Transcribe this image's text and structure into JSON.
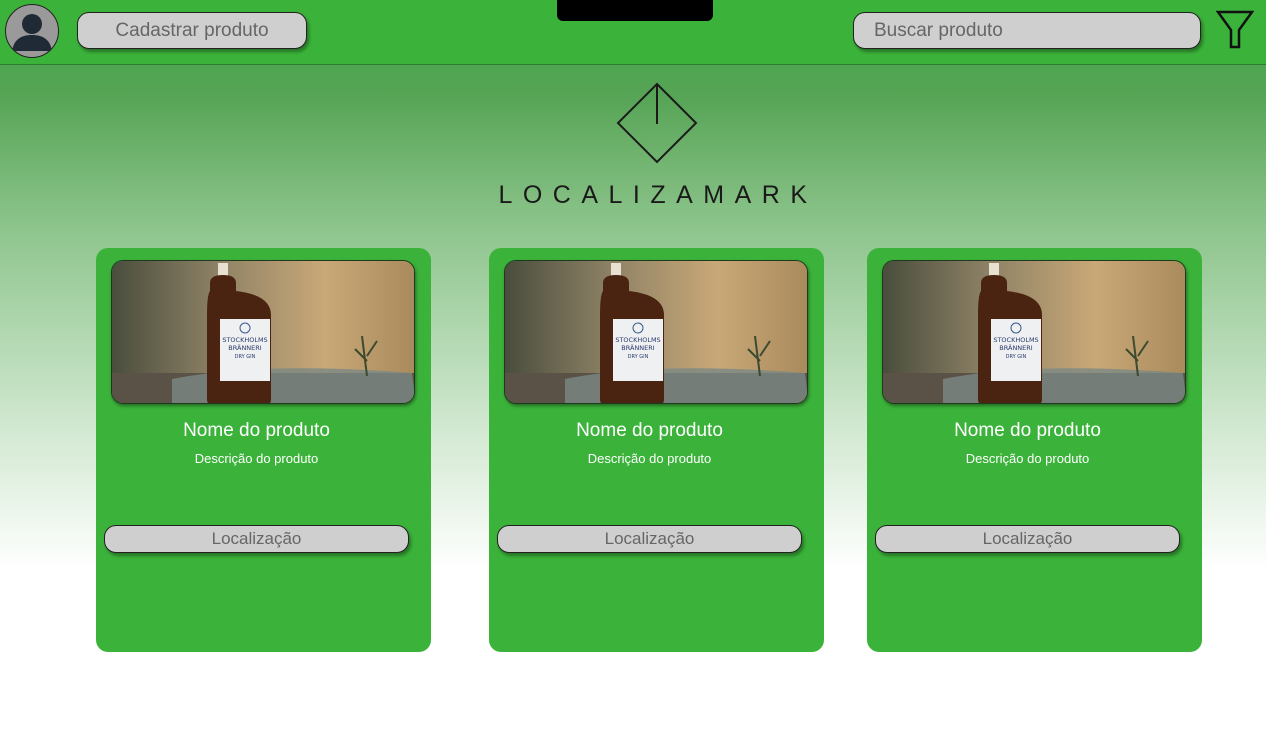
{
  "header": {
    "register_label": "Cadastrar produto",
    "search_placeholder": "Buscar produto"
  },
  "brand": {
    "name": "LOCALIZAMARK"
  },
  "products": [
    {
      "name": "Nome do produto",
      "description": "Descrição do produto",
      "location_label": "Localização",
      "image_label": "product-photo-gin-bottle",
      "bottle_text": [
        "STOCKHOLMS",
        "BRÄNNERI",
        "DRY GIN"
      ]
    },
    {
      "name": "Nome do produto",
      "description": "Descrição do produto",
      "location_label": "Localização",
      "image_label": "product-photo-gin-bottle",
      "bottle_text": [
        "STOCKHOLMS",
        "BRÄNNERI",
        "DRY GIN"
      ]
    },
    {
      "name": "Nome do produto",
      "description": "Descrição do produto",
      "location_label": "Localização",
      "image_label": "product-photo-gin-bottle",
      "bottle_text": [
        "STOCKHOLMS",
        "BRÄNNERI",
        "DRY GIN"
      ]
    }
  ],
  "colors": {
    "accent": "#3bb33a",
    "button_bg": "#cfcfcf",
    "card_text": "#ffffff"
  },
  "icons": {
    "avatar": "user-avatar-icon",
    "filter": "filter-icon",
    "logo": "diamond-logo-icon"
  }
}
